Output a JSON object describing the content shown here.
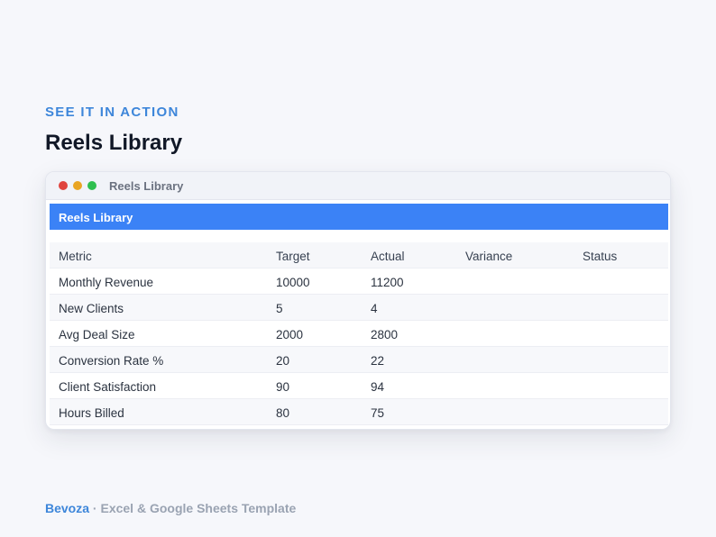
{
  "eyebrow": "SEE IT IN ACTION",
  "title": "Reels Library",
  "window": {
    "title": "Reels Library",
    "controls": [
      "close-dot",
      "minimize-dot",
      "maximize-dot"
    ]
  },
  "sheet": {
    "header": "Reels Library",
    "columns": [
      "Metric",
      "Target",
      "Actual",
      "Variance",
      "Status"
    ],
    "rows": [
      [
        "Monthly Revenue",
        "10000",
        "11200",
        "",
        ""
      ],
      [
        "New Clients",
        "5",
        "4",
        "",
        ""
      ],
      [
        "Avg Deal Size",
        "2000",
        "2800",
        "",
        ""
      ],
      [
        "Conversion Rate %",
        "20",
        "22",
        "",
        ""
      ],
      [
        "Client Satisfaction",
        "90",
        "94",
        "",
        ""
      ],
      [
        "Hours Billed",
        "80",
        "75",
        "",
        ""
      ]
    ]
  },
  "footer": {
    "brand": "Bevoza",
    "separator": " · ",
    "tagline": "Excel & Google Sheets Template"
  },
  "colors": {
    "accent": "#3d86da",
    "sheet_header": "#3b82f6",
    "close": "#e0443e",
    "minimize": "#e9a523",
    "maximize": "#2fbf4f"
  }
}
